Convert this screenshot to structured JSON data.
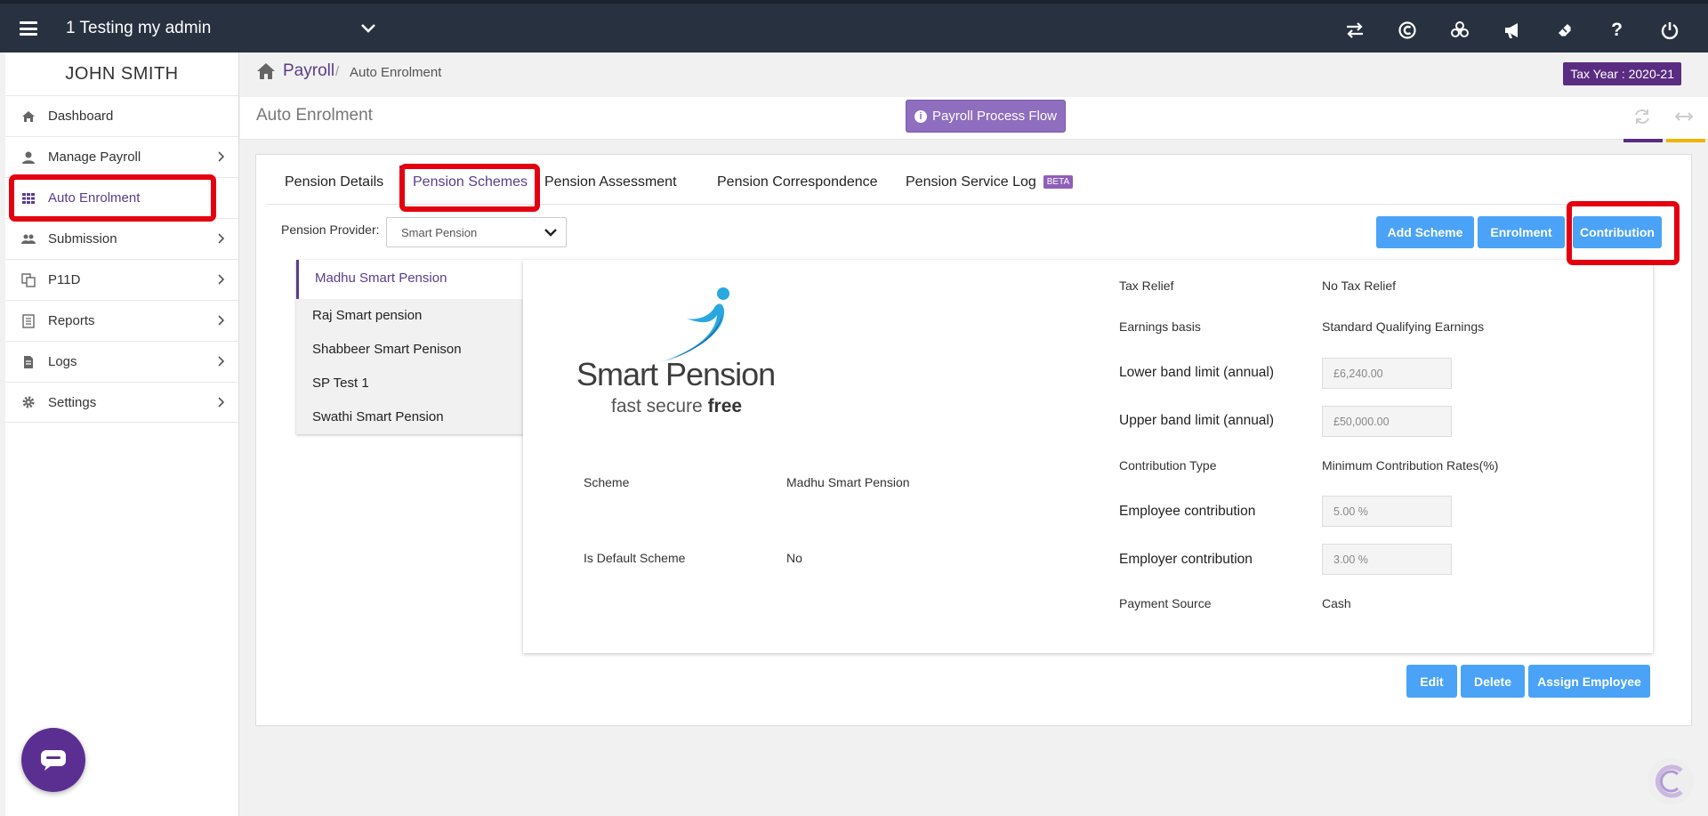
{
  "header": {
    "company": "1 Testing my admin",
    "icons": [
      "swap-icon",
      "copyright-icon",
      "biohazard-icon",
      "bullhorn-icon",
      "ticket-icon",
      "question-icon",
      "power-icon"
    ],
    "help_glyph": "?"
  },
  "sidebar": {
    "user": "JOHN SMITH",
    "items": [
      {
        "label": "Dashboard",
        "icon": "home-icon",
        "has_caret": false
      },
      {
        "label": "Manage Payroll",
        "icon": "user-icon",
        "has_caret": true
      },
      {
        "label": "Auto Enrolment",
        "icon": "grid-icon",
        "has_caret": false,
        "active": true
      },
      {
        "label": "Submission",
        "icon": "users-icon",
        "has_caret": true
      },
      {
        "label": "P11D",
        "icon": "copy-icon",
        "has_caret": true
      },
      {
        "label": "Reports",
        "icon": "report-icon",
        "has_caret": true
      },
      {
        "label": "Logs",
        "icon": "log-icon",
        "has_caret": true
      },
      {
        "label": "Settings",
        "icon": "gear-icon",
        "has_caret": true
      }
    ]
  },
  "breadcrumb": {
    "root": "Payroll",
    "separator": "/",
    "current": "Auto Enrolment"
  },
  "tax_year": "Tax Year : 2020-21",
  "page": {
    "title": "Auto Enrolment",
    "flow_button": "Payroll Process Flow"
  },
  "tabs": {
    "details": "Pension Details",
    "schemes": "Pension Schemes",
    "assessment": "Pension Assessment",
    "correspondence": "Pension Correspondence",
    "service_log": "Pension Service Log",
    "beta": "BETA"
  },
  "provider": {
    "label": "Pension Provider:",
    "value": "Smart Pension"
  },
  "actions": {
    "add_scheme": "Add Scheme",
    "enrolment": "Enrolment",
    "contribution": "Contribution",
    "edit": "Edit",
    "delete": "Delete",
    "assign": "Assign Employee"
  },
  "schemes": [
    "Madhu Smart Pension",
    "Raj Smart pension",
    "Shabbeer Smart Penison",
    "SP Test 1",
    "Swathi Smart Pension"
  ],
  "logo": {
    "name": "Smart Pension",
    "tag_part1": "fast secure ",
    "tag_part2": "free"
  },
  "details": {
    "scheme_label": "Scheme",
    "scheme_value": "Madhu Smart Pension",
    "default_label": "Is Default Scheme",
    "default_value": "No",
    "tax_relief_label": "Tax Relief",
    "tax_relief_value": "No Tax Relief",
    "earnings_label": "Earnings basis",
    "earnings_value": "Standard Qualifying Earnings",
    "lower_label": "Lower band limit (annual)",
    "lower_value": "£6,240.00",
    "upper_label": "Upper band limit (annual)",
    "upper_value": "£50,000.00",
    "ctype_label": "Contribution Type",
    "ctype_value": "Minimum Contribution Rates(%)",
    "employee_label": "Employee contribution",
    "employee_value": "5.00 %",
    "employer_label": "Employer contribution",
    "employer_value": "3.00 %",
    "payment_label": "Payment Source",
    "payment_value": "Cash"
  },
  "colors": {
    "topbar": "#273140",
    "accent_purple": "#5a3d8a",
    "button_blue": "#4aa3f7",
    "highlight_red": "#e4000f",
    "tax_year_bg": "#5a2d82"
  }
}
